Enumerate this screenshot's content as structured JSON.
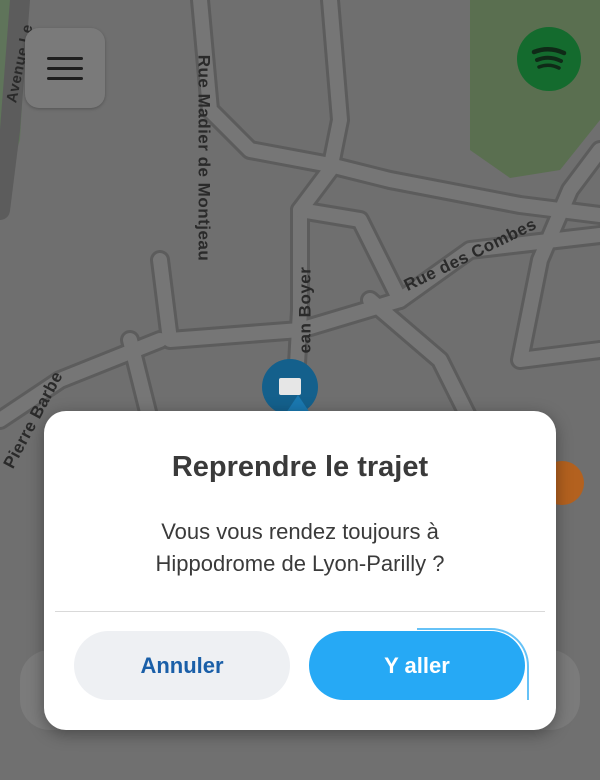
{
  "map": {
    "streets": [
      "Rue Madier de Montjeau",
      "Rue des Combes",
      "Pierre Barbe",
      "Avenue Le",
      "ean Boyer"
    ]
  },
  "menu": {
    "icon": "hamburger-menu-icon"
  },
  "spotify": {
    "icon": "spotify-icon",
    "color": "#146b2e"
  },
  "dialog": {
    "title": "Reprendre le trajet",
    "message_line1": "Vous vous rendez toujours à",
    "message_line2": "Hippodrome de Lyon-Parilly ?",
    "cancel_label": "Annuler",
    "go_label": "Y aller"
  },
  "colors": {
    "accent": "#26a9f5",
    "cancel_text": "#1a5fa8"
  }
}
